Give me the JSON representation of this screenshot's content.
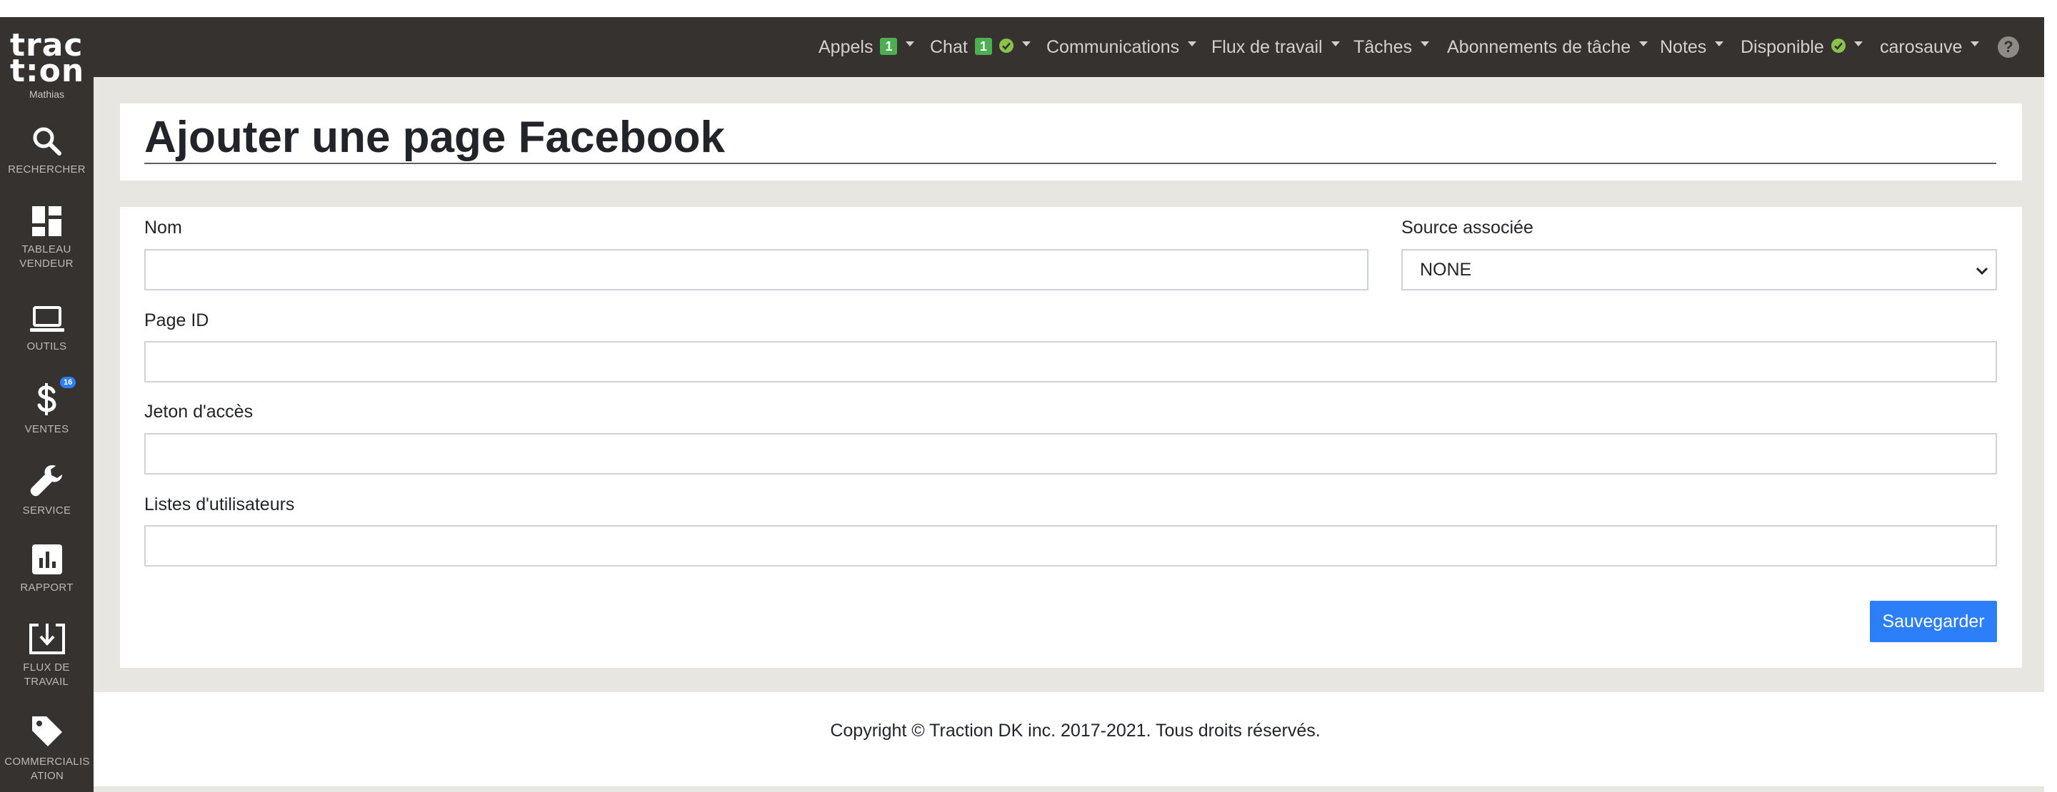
{
  "brand": {
    "logo_line1": "trac",
    "logo_line2": "t:on",
    "user_name": "Mathias"
  },
  "sidebar": {
    "items": [
      {
        "label": "RECHERCHER",
        "icon": "search-icon"
      },
      {
        "label": "TABLEAU VENDEUR",
        "icon": "dashboard-icon"
      },
      {
        "label": "OUTILS",
        "icon": "laptop-icon"
      },
      {
        "label": "VENTES",
        "icon": "dollar-icon",
        "badge": "16"
      },
      {
        "label": "SERVICE",
        "icon": "wrench-icon"
      },
      {
        "label": "RAPPORT",
        "icon": "bar-chart-icon"
      },
      {
        "label": "FLUX DE TRAVAIL",
        "icon": "download-tray-icon"
      },
      {
        "label": "COMMERCIALISATION",
        "icon": "tag-icon"
      }
    ]
  },
  "topnav": {
    "items": [
      {
        "label": "Appels",
        "badge": "1"
      },
      {
        "label": "Chat",
        "badge": "1",
        "status": "check-circle-icon"
      },
      {
        "label": "Communications"
      },
      {
        "label": "Flux de travail"
      },
      {
        "label": "Tâches"
      },
      {
        "label": "Abonnements de tâche"
      },
      {
        "label": "Notes"
      },
      {
        "label": "Disponible",
        "status": "check-circle-icon"
      },
      {
        "label": "carosauve"
      }
    ],
    "help_label": "?"
  },
  "page": {
    "title": "Ajouter une page Facebook"
  },
  "form": {
    "name_label": "Nom",
    "name_value": "",
    "source_label": "Source associée",
    "source_value": "NONE",
    "page_id_label": "Page ID",
    "page_id_value": "",
    "token_label": "Jeton d'accès",
    "token_value": "",
    "user_lists_label": "Listes d'utilisateurs",
    "user_lists_value": "",
    "save_label": "Sauvegarder"
  },
  "footer": {
    "copyright": "Copyright © Traction DK inc. 2017-2021. Tous droits réservés."
  },
  "colors": {
    "sidebar_bg": "#36322f",
    "content_bg": "#e8e6e1",
    "accent_blue": "#2d7ff9",
    "badge_green": "#4caf50",
    "status_green": "#8bc34a"
  }
}
